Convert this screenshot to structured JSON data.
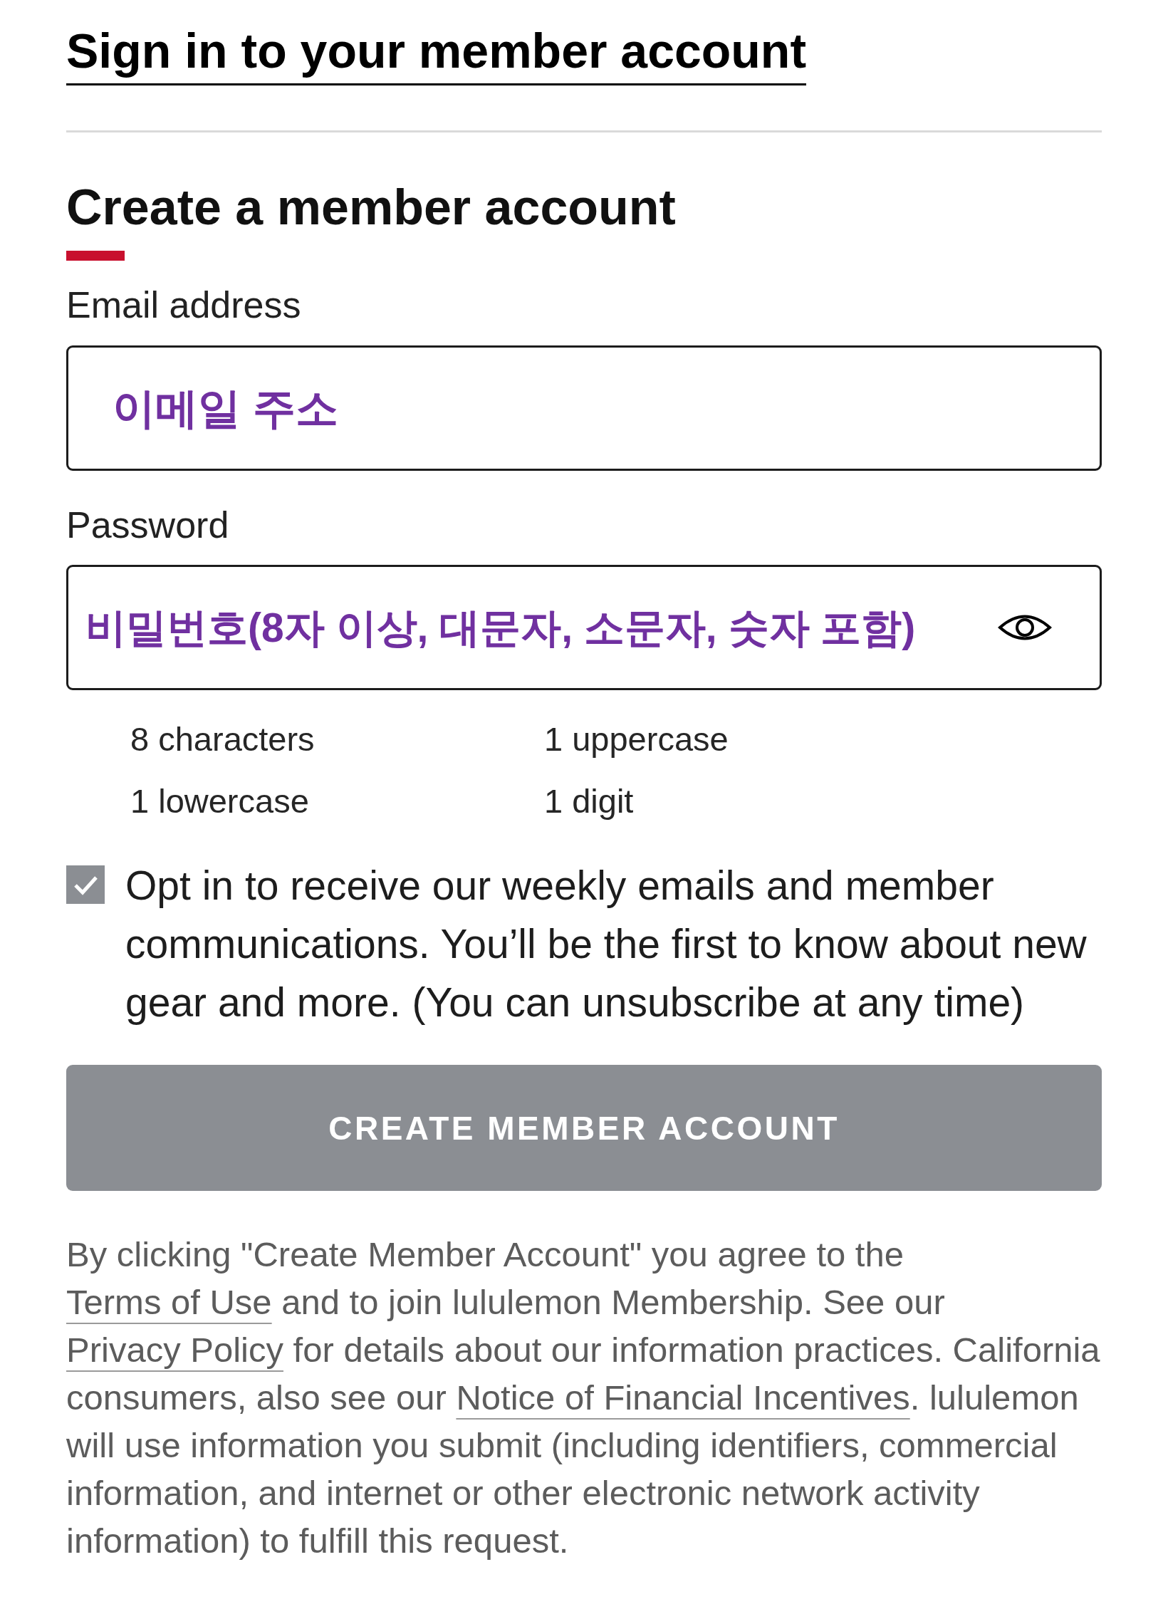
{
  "sign_in_link": "Sign in to your member account",
  "create_account": {
    "heading": "Create a member account",
    "email": {
      "label": "Email address",
      "placeholder": "이메일 주소"
    },
    "password": {
      "label": "Password",
      "placeholder": "비밀번호(8자 이상, 대문자, 소문자, 숫자 포함)"
    },
    "requirements": [
      "8 characters",
      "1 uppercase",
      "1 lowercase",
      "1 digit"
    ],
    "opt_in": {
      "checked": true,
      "text": "Opt in to receive our weekly emails and member communications. You’ll be the first to know about new gear and more. (You can unsubscribe at any time)"
    },
    "submit_button": {
      "label": "CREATE MEMBER ACCOUNT",
      "disabled": true
    },
    "legal": [
      {
        "kind": "text",
        "text": "By clicking \"Create Member Account\" you agree to the "
      },
      {
        "kind": "link",
        "text": "Terms of Use"
      },
      {
        "kind": "text",
        "text": " and to join lululemon Membership. See our "
      },
      {
        "kind": "link",
        "text": "Privacy Policy"
      },
      {
        "kind": "text",
        "text": " for details about our information practices. California consumers, also see our "
      },
      {
        "kind": "link",
        "text": "Notice of Financial Incentives"
      },
      {
        "kind": "text",
        "text": ". lululemon will use information you submit (including identifiers, commercial information, and internet or other electronic network activity information) to fulfill this request."
      }
    ]
  }
}
